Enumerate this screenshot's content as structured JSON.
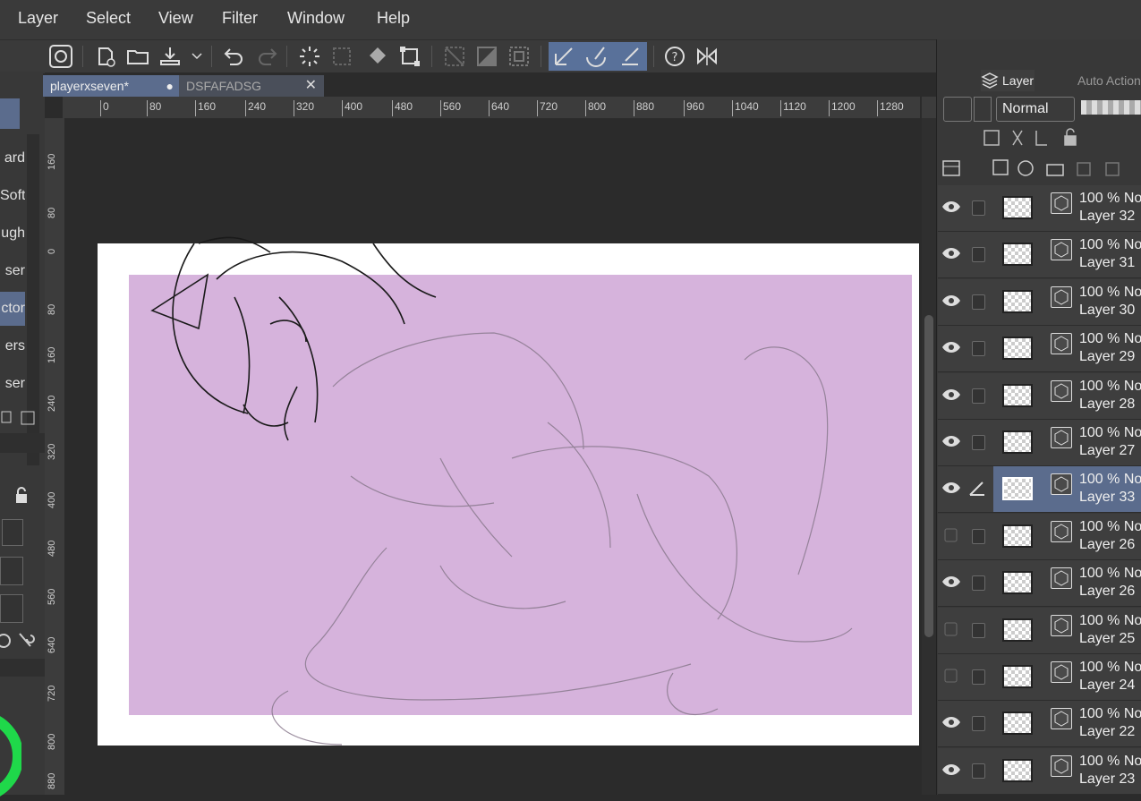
{
  "menu": [
    "Layer",
    "Select",
    "View",
    "Filter",
    "Window",
    "Help"
  ],
  "tabs": [
    {
      "label": "playerxseven*",
      "active": true
    },
    {
      "label": "DSFAFADSG",
      "active": false
    }
  ],
  "ruler_h": [
    "0",
    "80",
    "160",
    "240",
    "320",
    "400",
    "480",
    "560",
    "640",
    "720",
    "800",
    "880",
    "960",
    "1040",
    "1120",
    "1200",
    "1280"
  ],
  "ruler_v": [
    "160",
    "80",
    "0",
    "80",
    "160",
    "240",
    "320",
    "400",
    "480",
    "560",
    "640",
    "720",
    "800",
    "880"
  ],
  "left_subtools": [
    "ard",
    "Soft",
    "ugh",
    "ser",
    "ctor",
    "ers",
    "ser"
  ],
  "layer_panel": {
    "tab_layer": "Layer",
    "tab_auto": "Auto Action",
    "blend_mode": "Normal",
    "layers": [
      {
        "opacity": "100 %",
        "mode": "No",
        "name": "Layer 32",
        "visible": true,
        "selected": false
      },
      {
        "opacity": "100 %",
        "mode": "No",
        "name": "Layer 31",
        "visible": true,
        "selected": false
      },
      {
        "opacity": "100 %",
        "mode": "No",
        "name": "Layer 30",
        "visible": true,
        "selected": false
      },
      {
        "opacity": "100 %",
        "mode": "No",
        "name": "Layer 29",
        "visible": true,
        "selected": false
      },
      {
        "opacity": "100 %",
        "mode": "No",
        "name": "Layer 28",
        "visible": true,
        "selected": false
      },
      {
        "opacity": "100 %",
        "mode": "No",
        "name": "Layer 27",
        "visible": true,
        "selected": false
      },
      {
        "opacity": "100 %",
        "mode": "No",
        "name": "Layer 33",
        "visible": true,
        "selected": true
      },
      {
        "opacity": "100 %",
        "mode": "No",
        "name": "Layer 26",
        "visible": false,
        "selected": false
      },
      {
        "opacity": "100 %",
        "mode": "No",
        "name": "Layer 26",
        "visible": true,
        "selected": false
      },
      {
        "opacity": "100 %",
        "mode": "No",
        "name": "Layer 25",
        "visible": false,
        "selected": false
      },
      {
        "opacity": "100 %",
        "mode": "No",
        "name": "Layer 24",
        "visible": false,
        "selected": false
      },
      {
        "opacity": "100 %",
        "mode": "No",
        "name": "Layer 22",
        "visible": true,
        "selected": false
      },
      {
        "opacity": "100 %",
        "mode": "No",
        "name": "Layer 23",
        "visible": true,
        "selected": false
      }
    ]
  },
  "colors": {
    "accent": "#5b6c8d",
    "canvas_fill": "#d6b3dc",
    "paper": "#ffffff"
  }
}
